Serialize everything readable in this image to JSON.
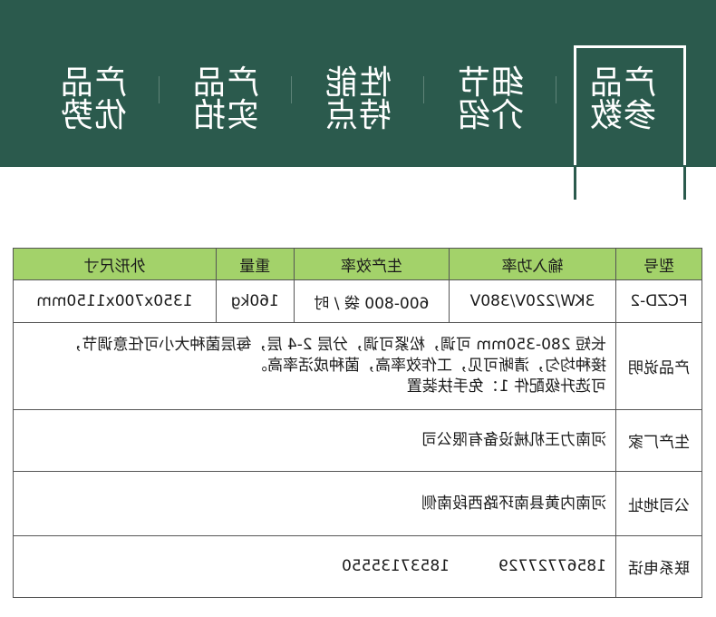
{
  "tabs": [
    {
      "label": "产品参数",
      "active": true
    },
    {
      "label": "细节介绍",
      "active": false
    },
    {
      "label": "性能特点",
      "active": false
    },
    {
      "label": "产品实拍",
      "active": false
    },
    {
      "label": "产品优势",
      "active": false
    }
  ],
  "spec_table": {
    "headers": [
      "型号",
      "输入功率",
      "生产效率",
      "重量",
      "外形尺寸"
    ],
    "row": [
      "FCZD-2",
      "3KW/220V/380V",
      "600-800 袋 / 时",
      "160kg",
      "1350x700x1150mm"
    ]
  },
  "description": {
    "label": "产品说明",
    "lines": [
      "长短 280-350mm 可调，松紧可调，分层 2-4 层，每层菌种大小可任意调节，",
      "接种均匀，清晰可见，工作效率高，菌种成活率高。",
      "可选升级配件 1：免手扶装置"
    ]
  },
  "manufacturer": {
    "label": "生产厂家",
    "value": "河南力王机械设备有限公司"
  },
  "address": {
    "label": "公司地址",
    "value": "河南内黄县南环路西段南侧"
  },
  "phone": {
    "label": "联系电话",
    "values": [
      "18567727729",
      "18537135550"
    ]
  },
  "colors": {
    "banner": "#2b5a4d",
    "header_row": "#a3d26a"
  }
}
